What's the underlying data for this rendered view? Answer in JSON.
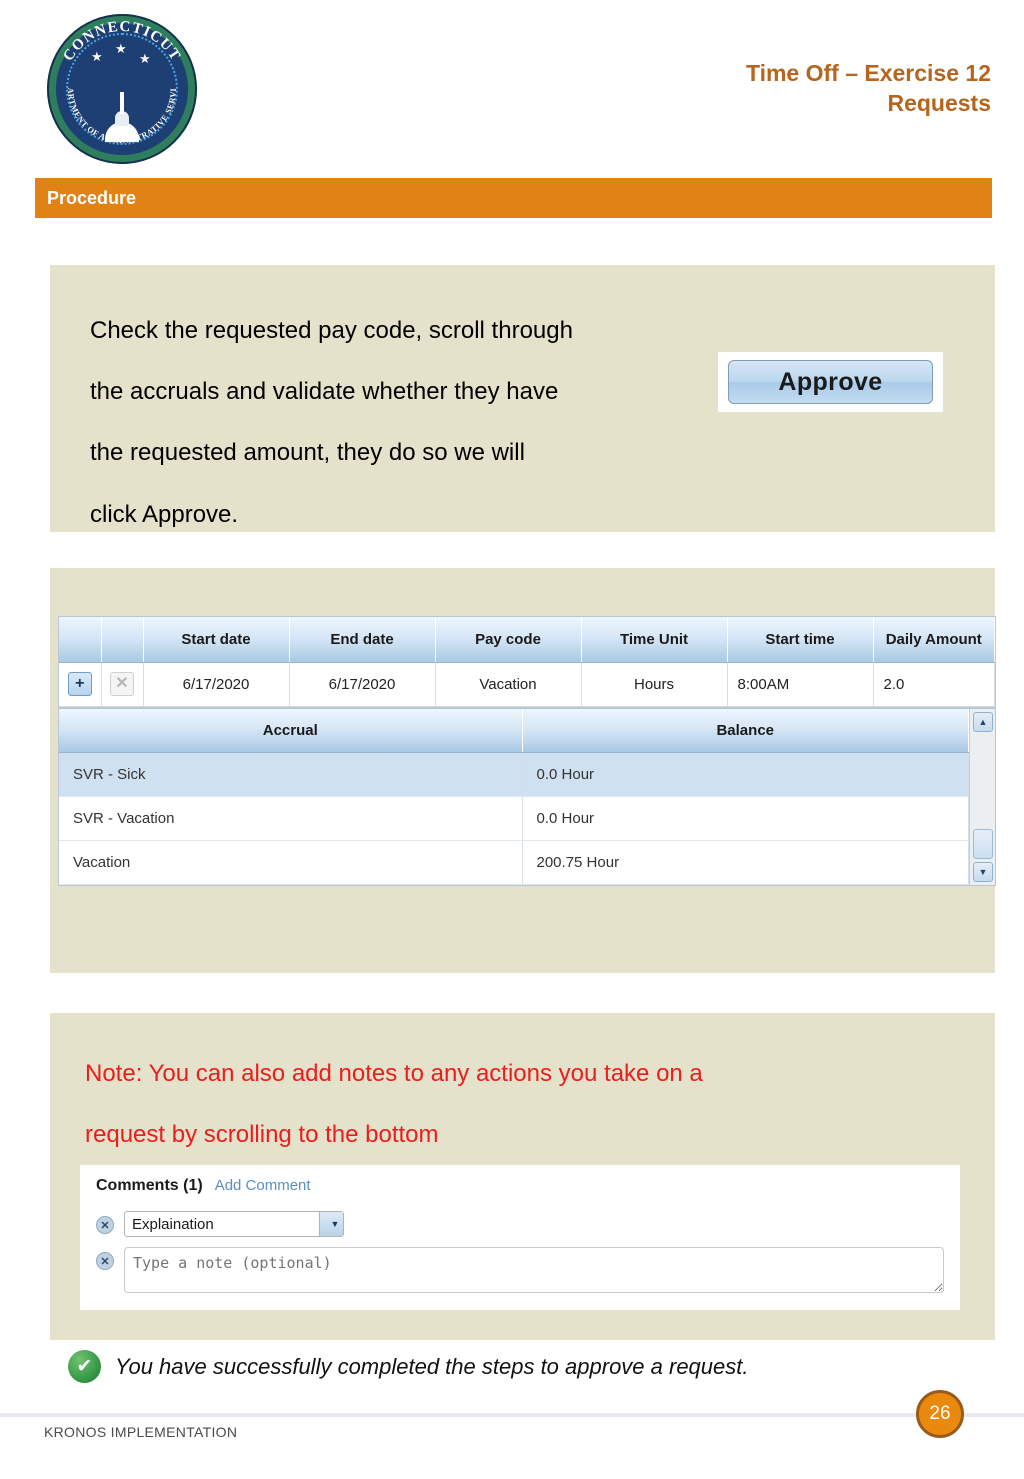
{
  "header": {
    "title_line1": "Time Off – Exercise 12",
    "title_line2": "Requests",
    "title_color": "#b5651d",
    "logo": {
      "top_text": "CONNECTICUT",
      "bottom_text": "DEPARTMENT OF ADMINISTRATIVE SERVICES",
      "star": "★"
    }
  },
  "procedure": {
    "label": "Procedure",
    "color": "#e08214"
  },
  "instruction": {
    "line1": "Check the requested pay code, scroll through",
    "line2": "the accruals and validate whether they have",
    "line3": "the requested amount, they do so we will",
    "line4": "click Approve."
  },
  "approve_button": {
    "label": "Approve"
  },
  "request_table": {
    "headers": [
      "",
      "",
      "Start date",
      "End date",
      "Pay code",
      "Time Unit",
      "Start time",
      "Daily Amount"
    ],
    "add_icon": "+",
    "delete_icon": "✕",
    "rows": [
      {
        "start_date": "6/17/2020",
        "end_date": "6/17/2020",
        "pay_code": "Vacation",
        "time_unit": "Hours",
        "start_time": "8:00AM",
        "daily_amount": "2.0"
      }
    ]
  },
  "accrual_table": {
    "headers": [
      "Accrual",
      "Balance"
    ],
    "rows": [
      {
        "accrual": "SVR - Sick",
        "balance": "0.0 Hour",
        "selected": true
      },
      {
        "accrual": "SVR - Vacation",
        "balance": "0.0 Hour",
        "selected": false
      },
      {
        "accrual": "Vacation",
        "balance": "200.75 Hour",
        "selected": false
      }
    ],
    "scrollbar": {
      "up_arrow": "▲",
      "down_arrow": "▼"
    }
  },
  "note": {
    "line1": "Note: You can also add notes to any actions you take on a",
    "line2": "request by scrolling to the bottom",
    "color": "#ee1c1c"
  },
  "comments": {
    "title": "Comments (1)",
    "add_link": "Add Comment",
    "delete_icon": "✕",
    "select_value": "Explaination",
    "select_arrow": "▼",
    "note_placeholder": "Type a note (optional)"
  },
  "success": {
    "icon": "✔",
    "text": "You have successfully completed the steps to approve a request."
  },
  "footer": {
    "label": "KRONOS IMPLEMENTATION",
    "page_number": "26"
  }
}
